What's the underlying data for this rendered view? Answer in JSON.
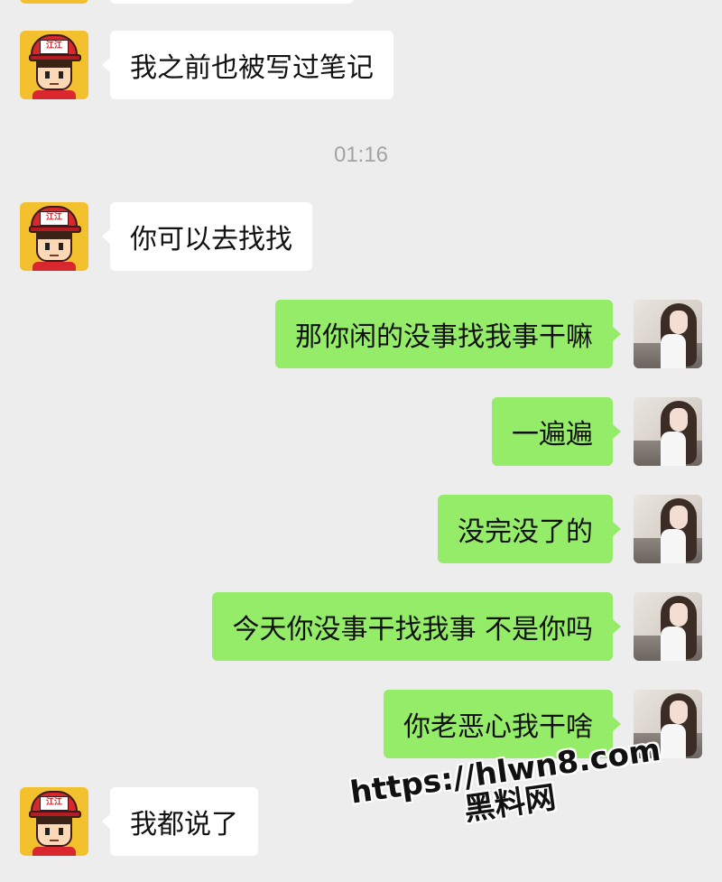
{
  "chat": {
    "timestamp": "01:16",
    "messages": [
      {
        "side": "left",
        "text": "我之前也被写过笔记"
      },
      {
        "side": "left",
        "text": "你可以去找找"
      },
      {
        "side": "right",
        "text": "那你闲的没事找我事干嘛"
      },
      {
        "side": "right",
        "text": "一遍遍"
      },
      {
        "side": "right",
        "text": "没完没了的"
      },
      {
        "side": "right",
        "text": "今天你没事干找我事 不是你吗"
      },
      {
        "side": "right",
        "text": "你老恶心我干啥"
      },
      {
        "side": "left",
        "text": "我都说了"
      }
    ],
    "left_avatar_cap_text": "江江"
  },
  "watermark": {
    "url": "https://hlwn8.com",
    "name": "黑料网"
  },
  "colors": {
    "background": "#ededed",
    "incoming_bubble": "#ffffff",
    "outgoing_bubble": "#95ec69",
    "timestamp": "#a3a3a3"
  }
}
